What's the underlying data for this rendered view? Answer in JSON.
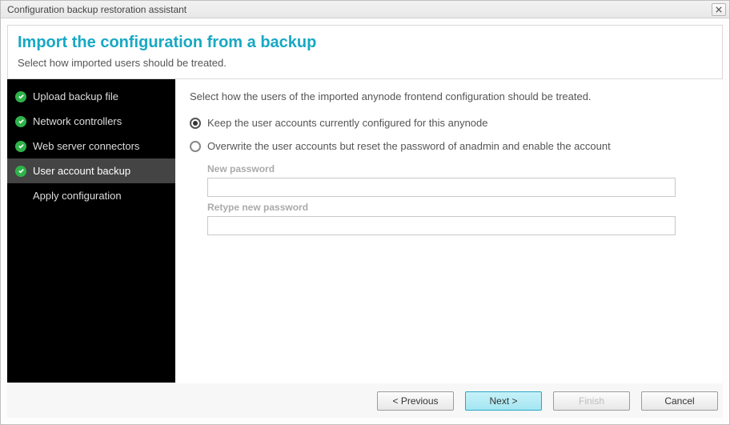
{
  "window": {
    "title": "Configuration backup restoration assistant"
  },
  "header": {
    "title": "Import the configuration from a backup",
    "subtitle": "Select how imported users should be treated."
  },
  "sidebar": {
    "steps": [
      {
        "label": "Upload backup file",
        "done": true,
        "active": false
      },
      {
        "label": "Network controllers",
        "done": true,
        "active": false
      },
      {
        "label": "Web server connectors",
        "done": true,
        "active": false
      },
      {
        "label": "User account backup",
        "done": true,
        "active": true
      },
      {
        "label": "Apply configuration",
        "done": false,
        "active": false
      }
    ]
  },
  "main": {
    "instruction": "Select how the users of the imported anynode frontend configuration should be treated.",
    "option_keep": "Keep the user accounts currently configured for this anynode",
    "option_overwrite": "Overwrite the user accounts but reset the password of anadmin and enable the account",
    "new_password_label": "New password",
    "retype_password_label": "Retype new password",
    "new_password_value": "",
    "retype_password_value": ""
  },
  "footer": {
    "previous": "< Previous",
    "next": "Next >",
    "finish": "Finish",
    "cancel": "Cancel"
  }
}
